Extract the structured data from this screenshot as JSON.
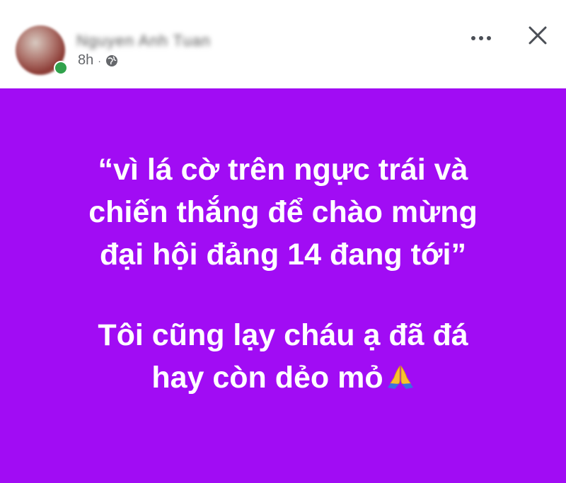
{
  "post": {
    "author_name": "Nguyen Anh Tuan",
    "timestamp": "8h",
    "separator": "·",
    "audience_icon": "globe-icon",
    "more_icon": "more-horizontal-icon",
    "close_icon": "close-icon",
    "background_color": "#a10cf4",
    "text_color": "#ffffff",
    "paragraph1": [
      "“vì lá cờ trên ngực trái và",
      "chiến thắng để chào mừng",
      "đại hội đảng 14 đang tới”"
    ],
    "paragraph2": [
      "Tôi cũng lạy cháu ạ đã đá",
      "hay còn dẻo mỏ"
    ],
    "emoji": "folded-hands-icon"
  }
}
